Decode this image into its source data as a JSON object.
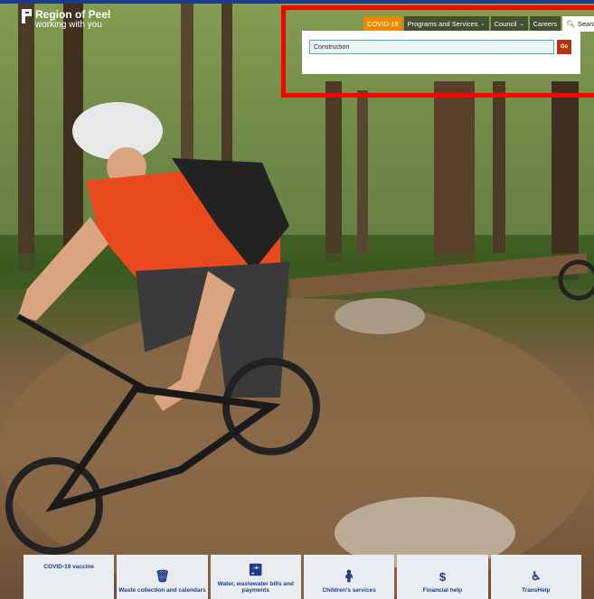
{
  "header": {
    "logo_line1": "Region of Peel",
    "logo_line2": "working with you"
  },
  "nav": {
    "covid": "COVID-19",
    "programs": "Programs and Services",
    "council": "Council",
    "careers": "Careers",
    "search": "Search"
  },
  "search": {
    "value": "Construction",
    "go_label": "Go"
  },
  "tiles": [
    {
      "label": "COVID-19 vaccine",
      "icon": "none"
    },
    {
      "label": "Waste collection and calendars",
      "icon": "trash-bin-icon"
    },
    {
      "label": "Water, wastewater bills and payments",
      "icon": "faucet-icon"
    },
    {
      "label": "Children's services",
      "icon": "child-icon"
    },
    {
      "label": "Financial help",
      "icon": "dollar-icon"
    },
    {
      "label": "TransHelp",
      "icon": "wheelchair-icon"
    }
  ],
  "colors": {
    "brand": "#1d3b8a",
    "covid_tab": "#e98a00",
    "go_button": "#b33610",
    "highlight": "#ff0000"
  }
}
